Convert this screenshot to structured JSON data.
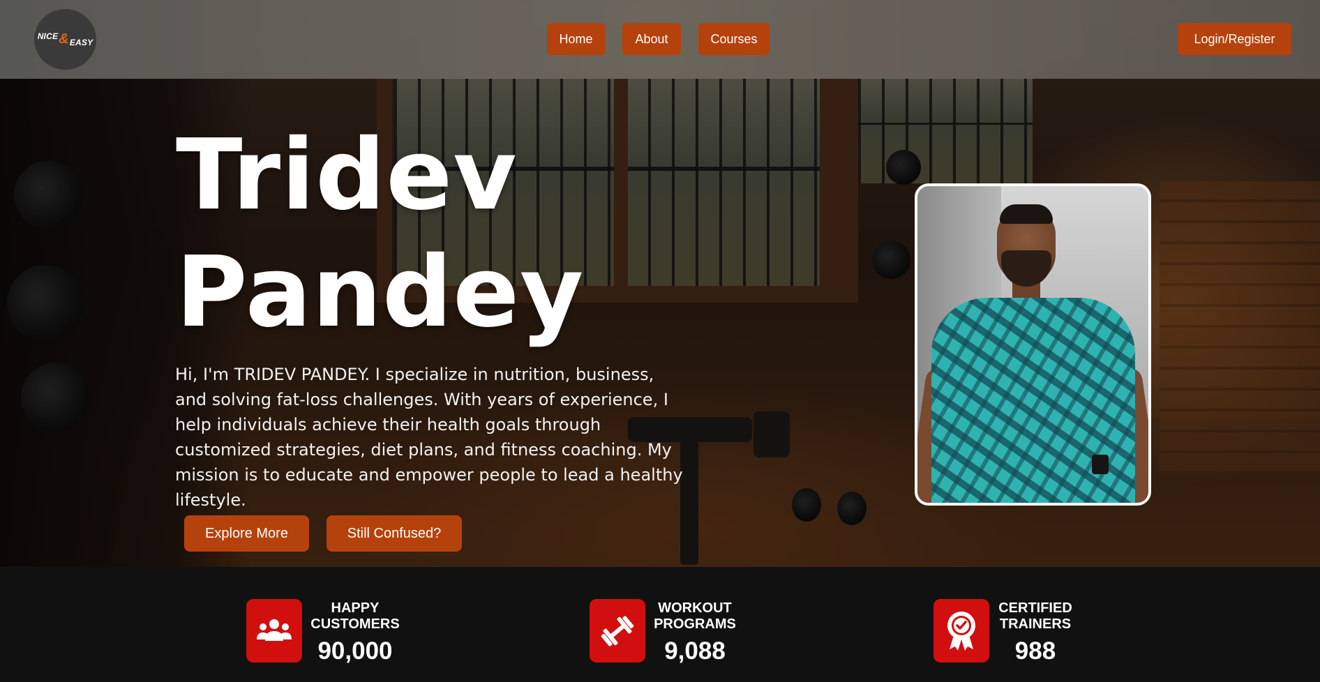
{
  "nav": {
    "logo": {
      "word1": "NICE",
      "amp": "&",
      "word2": "EASY"
    },
    "links": [
      "Home",
      "About",
      "Courses"
    ],
    "login_label": "Login/Register"
  },
  "hero": {
    "name_line1": "Tridev",
    "name_line2": "Pandey",
    "description": "Hi, I'm TRIDEV PANDEY. I specialize in nutrition, business, and solving fat-loss challenges. With years of experience, I help individuals achieve their health goals through customized strategies, diet plans, and fitness coaching. My mission is to educate and empower people to lead a healthy lifestyle.",
    "buttons": {
      "explore": "Explore More",
      "confused": "Still Confused?"
    }
  },
  "stats": [
    {
      "label_line1": "HAPPY",
      "label_line2": "CUSTOMERS",
      "value": "90,000",
      "icon": "users-icon"
    },
    {
      "label_line1": "WORKOUT",
      "label_line2": "PROGRAMS",
      "value": "9,088",
      "icon": "dumbbell-icon"
    },
    {
      "label_line1": "CERTIFIED",
      "label_line2": "TRAINERS",
      "value": "988",
      "icon": "award-badge-icon"
    }
  ],
  "colors": {
    "accent": "#b5420c",
    "stat_icon_bg": "#d10f0f",
    "stats_bg": "#111111",
    "logo_amp": "#e0641e"
  }
}
